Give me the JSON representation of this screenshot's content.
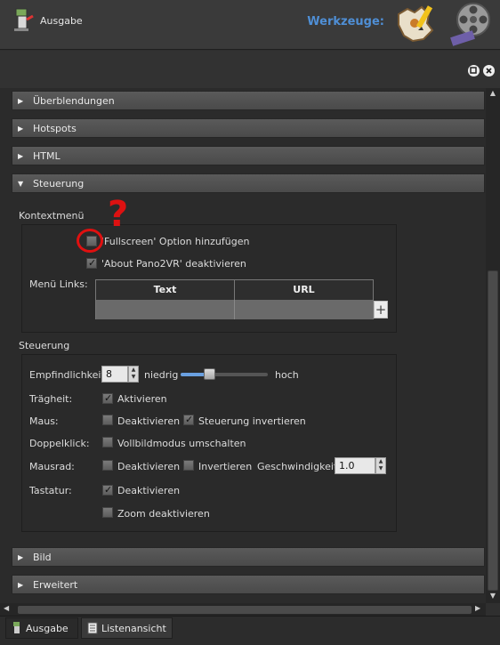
{
  "toolbar": {
    "label": "Werkzeuge:",
    "icons": [
      "map-tool-icon",
      "film-tool-icon"
    ]
  },
  "panel": {
    "title": "Ausgabe",
    "buttons": [
      "float-button",
      "close-button"
    ]
  },
  "sections": {
    "ueberblendungen": "Überblendungen",
    "hotspots": "Hotspots",
    "html": "HTML",
    "steuerung": "Steuerung",
    "bild": "Bild",
    "erweitert": "Erweitert"
  },
  "kontextmenu": {
    "group_label": "Kontextmenü",
    "fullscreen_label": "'Fullscreen' Option hinzufügen",
    "fullscreen_checked": false,
    "about_label": "'About Pano2VR' deaktivieren",
    "about_checked": true,
    "menu_links_label": "Menü Links:",
    "table_headers": [
      "Text",
      "URL"
    ],
    "add_button": "+"
  },
  "steuerung": {
    "group_label": "Steuerung",
    "empfindlichkeit_label": "Empfindlichkeit:",
    "empfindlichkeit_value": "8",
    "niedrig_label": "niedrig",
    "hoch_label": "hoch",
    "slider_level": 0.33,
    "traegheit_label": "Trägheit:",
    "traegheit_option": "Aktivieren",
    "traegheit_checked": true,
    "maus_label": "Maus:",
    "maus_deaktivieren": "Deaktivieren",
    "maus_deaktivieren_checked": false,
    "maus_invertieren": "Steuerung invertieren",
    "maus_invertieren_checked": true,
    "doppelklick_label": "Doppelklick:",
    "doppelklick_option": "Vollbildmodus umschalten",
    "doppelklick_checked": false,
    "mausrad_label": "Mausrad:",
    "mausrad_deaktivieren": "Deaktivieren",
    "mausrad_deaktivieren_checked": false,
    "mausrad_invertieren": "Invertieren",
    "mausrad_invertieren_checked": false,
    "geschwindigkeit_label": "Geschwindigkeit:",
    "geschwindigkeit_value": "1.0",
    "tastatur_label": "Tastatur:",
    "tastatur_deaktivieren": "Deaktivieren",
    "tastatur_deaktivieren_checked": true,
    "zoom_deaktivieren": "Zoom deaktivieren",
    "zoom_deaktivieren_checked": false
  },
  "annotation": {
    "mark": "?"
  },
  "tabs": {
    "ausgabe": "Ausgabe",
    "listenansicht": "Listenansicht"
  },
  "colors": {
    "accent": "#4f8fd6",
    "annotation": "#e01010"
  }
}
